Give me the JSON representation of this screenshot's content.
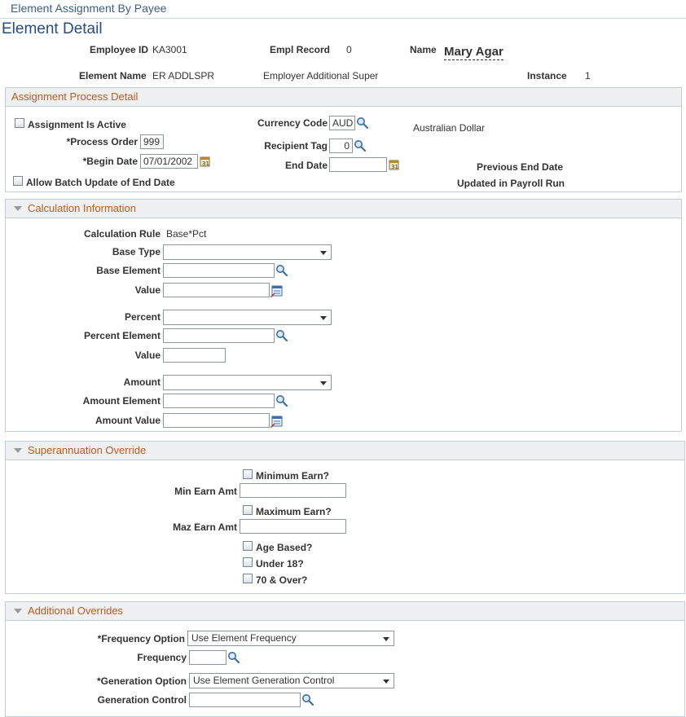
{
  "header": {
    "breadcrumb": "Element Assignment By Payee",
    "page_title": "Element Detail"
  },
  "employee": {
    "employee_id_label": "Employee ID",
    "employee_id": "KA3001",
    "empl_record_label": "Empl Record",
    "empl_record": "0",
    "name_label": "Name",
    "name": "Mary Agar",
    "element_name_label": "Element Name",
    "element_name": "ER ADDLSPR",
    "element_desc": "Employer Additional Super",
    "instance_label": "Instance",
    "instance": "1"
  },
  "assignment": {
    "title": "Assignment Process Detail",
    "active_label": "Assignment Is Active",
    "process_order_label": "*Process Order",
    "process_order": "999",
    "begin_date_label": "*Begin Date",
    "begin_date": "07/01/2002",
    "batch_update_label": "Allow Batch Update of End Date",
    "currency_code_label": "Currency Code",
    "currency_code": "AUD",
    "currency_desc": "Australian Dollar",
    "recipient_tag_label": "Recipient Tag",
    "recipient_tag": "0",
    "end_date_label": "End Date",
    "end_date": "",
    "prev_end_date_label": "Previous End Date",
    "updated_payroll_label": "Updated in Payroll Run"
  },
  "calculation": {
    "title": "Calculation Information",
    "calc_rule_label": "Calculation Rule",
    "calc_rule": "Base*Pct",
    "base_type_label": "Base Type",
    "base_type": "",
    "base_element_label": "Base Element",
    "base_element": "",
    "base_value_label": "Value",
    "base_value": "",
    "percent_label": "Percent",
    "percent": "",
    "percent_element_label": "Percent Element",
    "percent_element": "",
    "percent_value_label": "Value",
    "percent_value": "",
    "amount_label": "Amount",
    "amount": "",
    "amount_element_label": "Amount Element",
    "amount_element": "",
    "amount_value_label": "Amount Value",
    "amount_value": ""
  },
  "superannuation": {
    "title": "Superannuation Override",
    "minimum_earn_label": "Minimum Earn?",
    "min_earn_amt_label": "Min Earn Amt",
    "min_earn_amt": "",
    "maximum_earn_label": "Maximum Earn?",
    "max_earn_amt_label": "Maz Earn Amt",
    "max_earn_amt": "",
    "age_based_label": "Age Based?",
    "under_18_label": "Under 18?",
    "over_70_label": "70 & Over?"
  },
  "additional": {
    "title": "Additional Overrides",
    "frequency_option_label": "*Frequency Option",
    "frequency_option": "Use Element Frequency",
    "frequency_label": "Frequency",
    "frequency": "",
    "generation_option_label": "*Generation Option",
    "generation_option": "Use Element Generation Control",
    "generation_control_label": "Generation Control",
    "generation_control": ""
  },
  "colors": {
    "section_title": "#c05a1d",
    "page_title": "#244e82",
    "section_header_bg": "#eef0f2"
  }
}
